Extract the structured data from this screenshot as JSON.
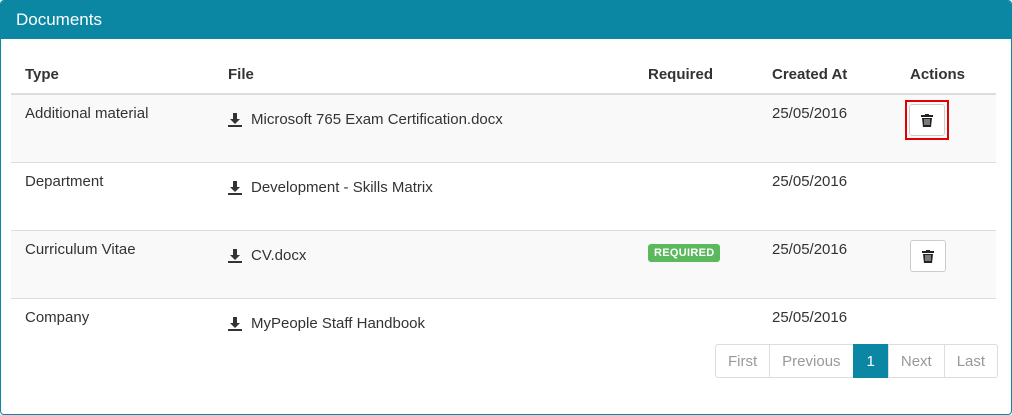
{
  "panel": {
    "title": "Documents"
  },
  "table": {
    "headers": {
      "type": "Type",
      "file": "File",
      "required": "Required",
      "created": "Created At",
      "actions": "Actions"
    },
    "rows": [
      {
        "type": "Additional material",
        "file": "Microsoft 765 Exam Certification.docx",
        "required": "",
        "created": "25/05/2016",
        "has_delete": true
      },
      {
        "type": "Department",
        "file": "Development - Skills Matrix",
        "required": "",
        "created": "25/05/2016",
        "has_delete": false
      },
      {
        "type": "Curriculum Vitae",
        "file": "CV.docx",
        "required": "REQUIRED",
        "created": "25/05/2016",
        "has_delete": true
      },
      {
        "type": "Company",
        "file": "MyPeople Staff Handbook",
        "required": "",
        "created": "25/05/2016",
        "has_delete": false
      }
    ],
    "icons": {
      "file": "download-icon",
      "delete": "trash-icon"
    }
  },
  "pagination": {
    "first": "First",
    "previous": "Previous",
    "current": "1",
    "next": "Next",
    "last": "Last"
  },
  "colors": {
    "header_bg": "#0b87a4",
    "badge_bg": "#5cb85c",
    "highlight": "#e00000"
  }
}
